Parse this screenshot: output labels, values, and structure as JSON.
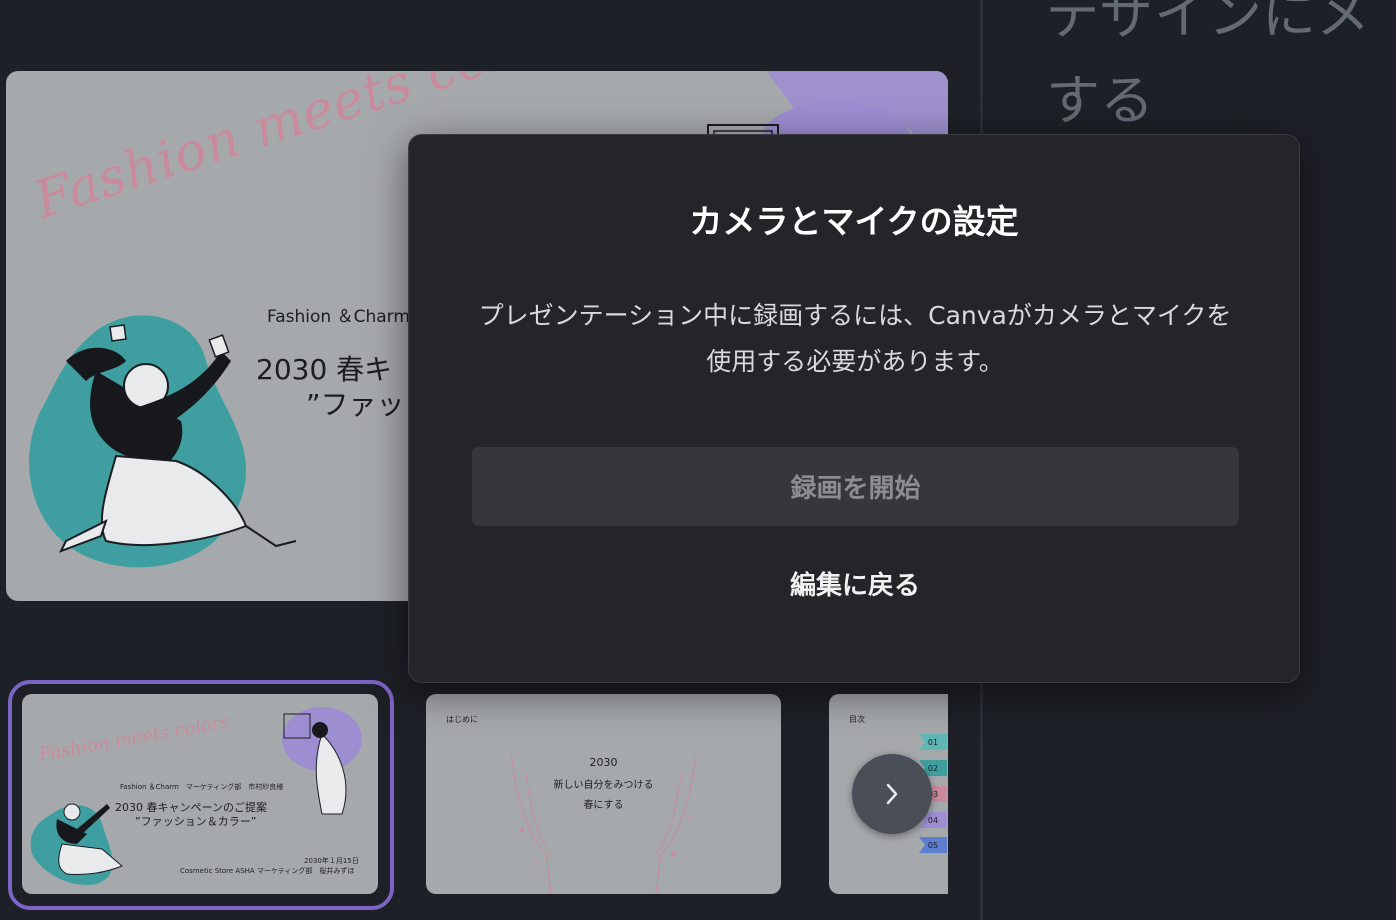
{
  "side_panel": {
    "heading": "デザインにメ\nする"
  },
  "main_slide": {
    "script_text": "Fashion meets colors",
    "brand_line": "Fashion ＆Charm",
    "title_line": "2030 春キ",
    "subtitle_line": "”ファッ"
  },
  "thumbnails": [
    {
      "script_text": "Fashion meets colors",
      "brand_line": "Fashion ＆Charm　マーケティング部　市村紗良様",
      "title_line": "2030 春キャンペーンのご提案",
      "subtitle_line": "”ファッション＆カラー”",
      "date_line": "2030年１月15日",
      "store_line": "Cosmetic Store ASHA マーケティング部　桜井みずほ",
      "selected": true
    },
    {
      "heading": "はじめに",
      "year": "2030",
      "line1": "新しい自分をみつける",
      "line2": "春にする"
    },
    {
      "heading": "目次",
      "tags": [
        "01",
        "02",
        "03",
        "04",
        "05"
      ]
    }
  ],
  "next_button": {
    "icon": "chevron-right-icon"
  },
  "modal": {
    "title": "カメラとマイクの設定",
    "description": "プレゼンテーション中に録画するには、Canvaがカメラとマイクを使用する必要があります。",
    "primary_button": "録画を開始",
    "secondary_button": "編集に戻る"
  },
  "colors": {
    "background": "#1d2026",
    "modal_bg": "#242528",
    "selection": "#7c64c4",
    "slide_bg": "#a6a9ac",
    "teal": "#3e9ea0",
    "lavender": "#9d8ed2",
    "pink": "#c98b9c"
  }
}
